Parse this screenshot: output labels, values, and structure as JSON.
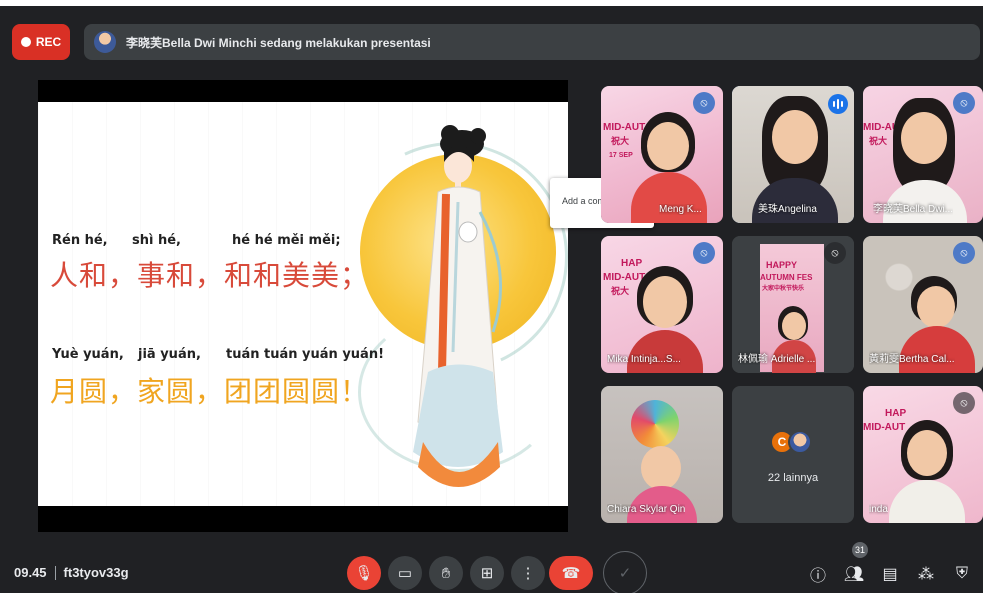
{
  "recording": {
    "label": "REC"
  },
  "banner": {
    "presenter_text": "李晓芙Bella Dwi Minchi sedang melakukan presentasi"
  },
  "slide": {
    "line1_pinyin": [
      "Rén hé,",
      "shì hé,",
      "hé hé měi měi;"
    ],
    "line1_hanzi": "人和，事和，和和美美；",
    "line2_pinyin": [
      "Yuè yuán,",
      "jiā yuán,",
      "tuán tuán yuán yuán!"
    ],
    "line2_hanzi": "月圆，家圆，团团圆圆！"
  },
  "comment_popup": {
    "label": "Add a comment"
  },
  "participants": [
    {
      "name": "Meng K...",
      "mic": "speaking-muted",
      "poster": [
        "MID-AUT",
        "祝大",
        "17 SEP"
      ]
    },
    {
      "name": "美珠Angelina",
      "mic": "speaking"
    },
    {
      "name": "李晓芙Bella Dwi...",
      "mic": "muted",
      "poster": [
        "MID-AUT",
        "祝大"
      ]
    },
    {
      "name": "Mika Intinja...S...",
      "mic": "muted",
      "poster": [
        "HAP",
        "MID-AUT",
        "祝大"
      ]
    },
    {
      "name": "林佩瑜 Adrielle ...",
      "mic": "muted",
      "poster": [
        "HAPPY",
        "AUTUMN FES",
        "大家中秋节快乐"
      ]
    },
    {
      "name": "黃莉雯Bertha Cal...",
      "mic": "muted"
    },
    {
      "name": "Chiara Skylar Qin",
      "mic": "none"
    },
    {
      "name": "",
      "mic": "none",
      "others": {
        "initial": "C",
        "label": "22 lainnya"
      }
    },
    {
      "name": "inda",
      "mic": "muted",
      "poster": [
        "HAP",
        "MID-AUT"
      ]
    }
  ],
  "meeting": {
    "time": "09.45",
    "code": "ft3tyov33g"
  },
  "controls": {
    "participants_count": "31",
    "icons": [
      "mic-off-icon",
      "camera-icon",
      "raise-hand-icon",
      "present-icon",
      "more-options-icon",
      "hang-up-icon",
      "check-icon",
      "info-icon",
      "people-icon",
      "chat-icon",
      "activities-icon",
      "security-icon"
    ]
  },
  "colors": {
    "bg": "#202124",
    "rec": "#d93025",
    "red": "#ea4335",
    "active_outline": "#8ab4f8",
    "speaking": "#1a73e8"
  }
}
